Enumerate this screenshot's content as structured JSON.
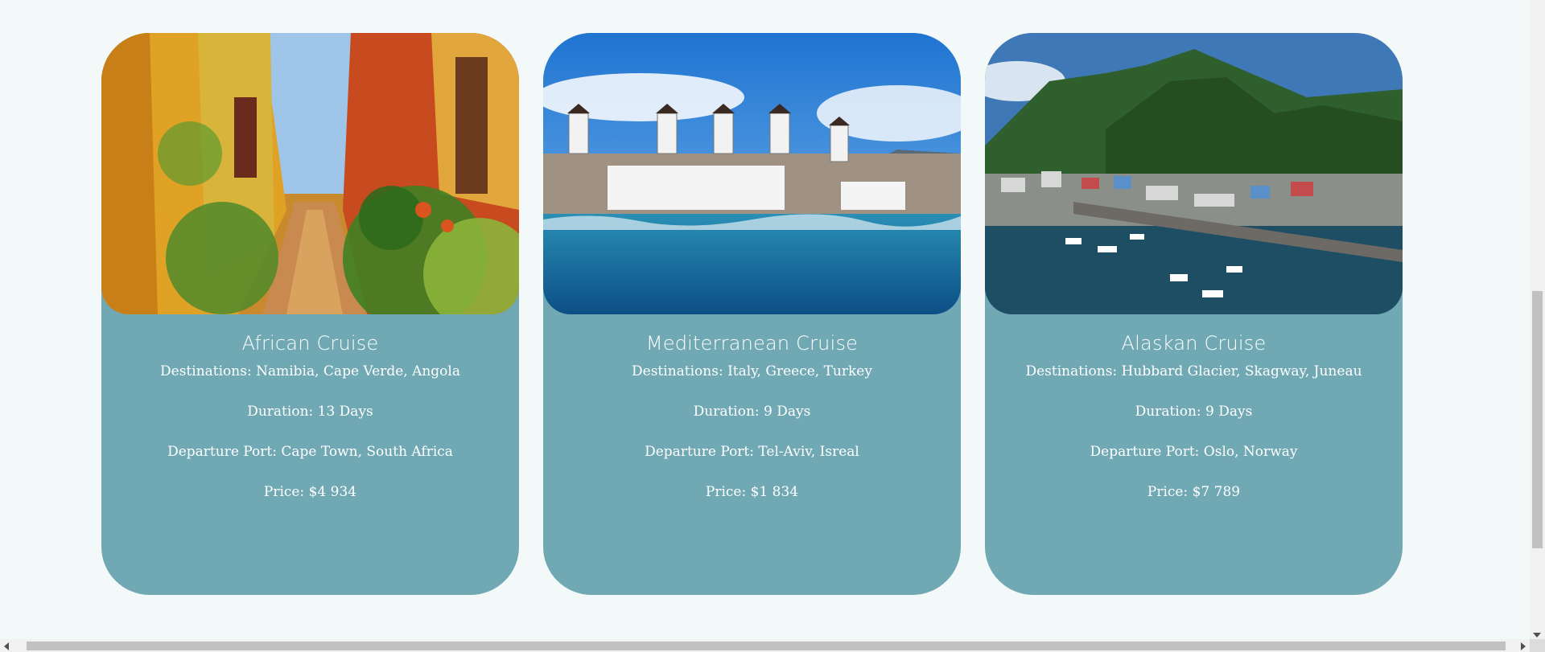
{
  "colors": {
    "page_background": "#f3f8f8",
    "card_background": "#70a9b3",
    "card_text": "#ffffff"
  },
  "cards": [
    {
      "image": "african-village-alley-photo",
      "title": "African Cruise",
      "destinations": "Destinations: Namibia, Cape Verde, Angola",
      "duration": "Duration: 13 Days",
      "departure": "Departure Port: Cape Town, South Africa",
      "price": "Price: $4 934"
    },
    {
      "image": "mykonos-windmills-photo",
      "title": "Mediterranean Cruise",
      "destinations": "Destinations: Italy, Greece, Turkey",
      "duration": "Duration: 9 Days",
      "departure": "Departure Port: Tel-Aviv, Isreal",
      "price": "Price: $1 834"
    },
    {
      "image": "alaskan-harbor-photo",
      "title": "Alaskan Cruise",
      "destinations": "Destinations: Hubbard Glacier, Skagway, Juneau",
      "duration": "Duration: 9 Days",
      "departure": "Departure Port: Oslo, Norway",
      "price": "Price: $7 789"
    }
  ]
}
